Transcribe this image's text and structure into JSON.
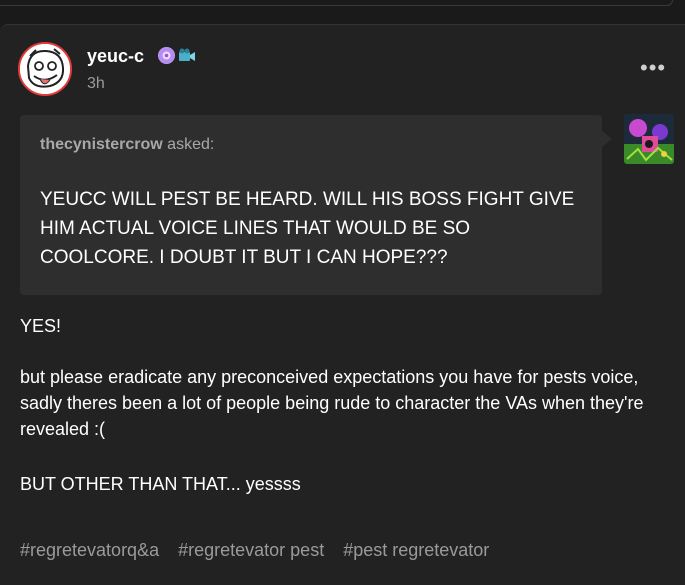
{
  "post": {
    "username": "yeuc-c",
    "timestamp": "3h",
    "more_label": "•••"
  },
  "ask": {
    "asker": "thecynistercrow",
    "asked_label": "asked:",
    "question": "YEUCC WILL PEST BE HEARD. WILL HIS BOSS FIGHT GIVE HIM ACTUAL VOICE LINES THAT WOULD BE SO COOLCORE. I DOUBT IT BUT I CAN HOPE???"
  },
  "answer": {
    "paragraphs": [
      "YES!",
      "but please eradicate any preconceived expectations you have for pests voice, sadly theres been a lot of people being rude to character the VAs when they're revealed :(",
      "BUT OTHER THAN THAT... yessss"
    ]
  },
  "tags": [
    "#regretevatorq&a",
    "#regretevator pest",
    "#pest regretevator"
  ],
  "icons": {
    "avatar": "cartoon-face-avatar-icon",
    "badge1": "purple-flower-badge-icon",
    "badge2": "film-camera-badge-icon",
    "more": "more-dots-icon",
    "asker_avatar": "colorful-art-avatar-icon"
  },
  "colors": {
    "background": "#1a1a1a",
    "post_background": "#222222",
    "askbox_background": "#2e2e2e",
    "text_primary": "#ffffff",
    "text_muted": "#9a9a9a",
    "avatar_ring": "#e33b3b"
  }
}
